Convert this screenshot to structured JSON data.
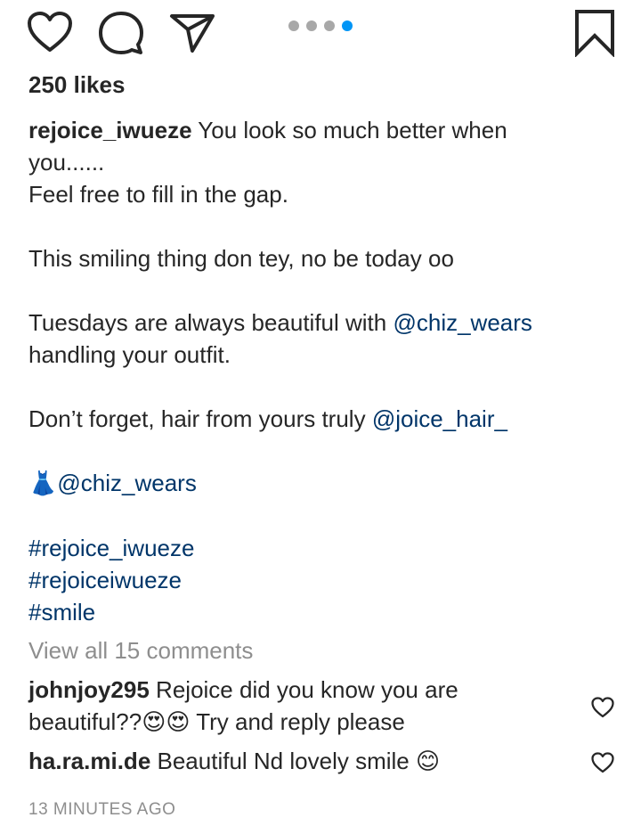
{
  "actions": {
    "like_icon": "heart-outline",
    "comment_icon": "speech-bubble",
    "share_icon": "paper-plane",
    "save_icon": "bookmark-outline",
    "carousel": {
      "count": 4,
      "active_index": 3,
      "active_color": "#0095f6",
      "inactive_color": "#a8a8a8"
    }
  },
  "likes": "250 likes",
  "caption": {
    "username": "rejoice_iwueze",
    "line1_text": " You look so much better when",
    "line2": "you......",
    "line3": "Feel free to fill in the gap.",
    "line5": "This smiling thing don tey, no be today oo",
    "line7_text": "Tuesdays are always beautiful with ",
    "line7_mention": "@chiz_wears",
    "line8": "handling your outfit.",
    "line10_text": "Don’t forget, hair from yours truly ",
    "line10_mention": "@joice_hair_",
    "line12_emoji": "👗",
    "line12_mention": "@chiz_wears",
    "hashtags": [
      "#rejoice_iwueze",
      "#rejoiceiwueze",
      "#smile"
    ]
  },
  "view_all_comments": "View all 15 comments",
  "comments": [
    {
      "username": "johnjoy295",
      "text_line1": " Rejoice did you know you are",
      "text_line2_pre": "beautiful??",
      "text_line2_emoji": "😍😍",
      "text_line2_post": " Try and reply please"
    },
    {
      "username": "ha.ra.mi.de",
      "text": " Beautiful Nd lovely smile ",
      "emoji": "😊"
    }
  ],
  "timestamp": "13 MINUTES AGO",
  "colors": {
    "text": "#262626",
    "link": "#003569",
    "muted": "#8e8e8e"
  }
}
